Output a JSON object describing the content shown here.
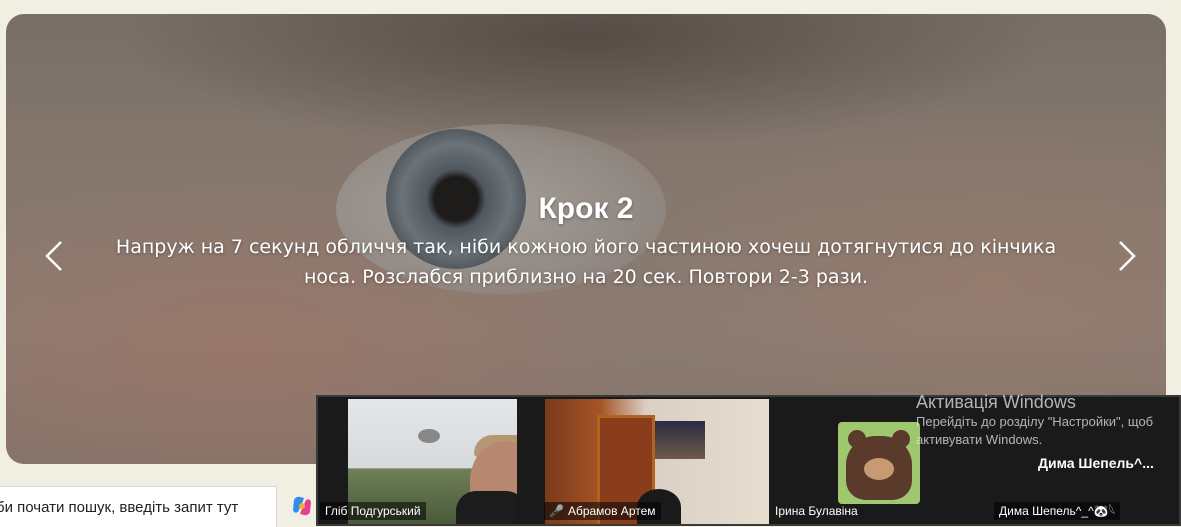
{
  "carousel": {
    "title": "Крок 2",
    "text": "Напруж на 7 секунд обличчя так, ніби кожною його частиною хочеш дотягнутися до кінчика носа. Розслабся приблизно на 20 сек. Повтори 2-3 рази.",
    "prev_icon": "chevron-left-icon",
    "next_icon": "chevron-right-icon"
  },
  "taskbar": {
    "search_text": "би почати пошук, введіть запит тут",
    "copilot_icon": "copilot-icon"
  },
  "meeting": {
    "participants": [
      {
        "name": "Гліб Подгурський"
      },
      {
        "name": "Абрамов Артем",
        "muted": true
      },
      {
        "name": "Ірина Булавіна"
      },
      {
        "name": "Дима Шепель^_^🐼𓆩"
      }
    ],
    "avatar_name": "Дима  Шепель^...",
    "muted_icon": "mic-off-icon"
  },
  "watermark": {
    "title": "Активація Windows",
    "line1": "Перейдіть до розділу \"Настройки\", щоб",
    "line2": "активувати Windows."
  }
}
